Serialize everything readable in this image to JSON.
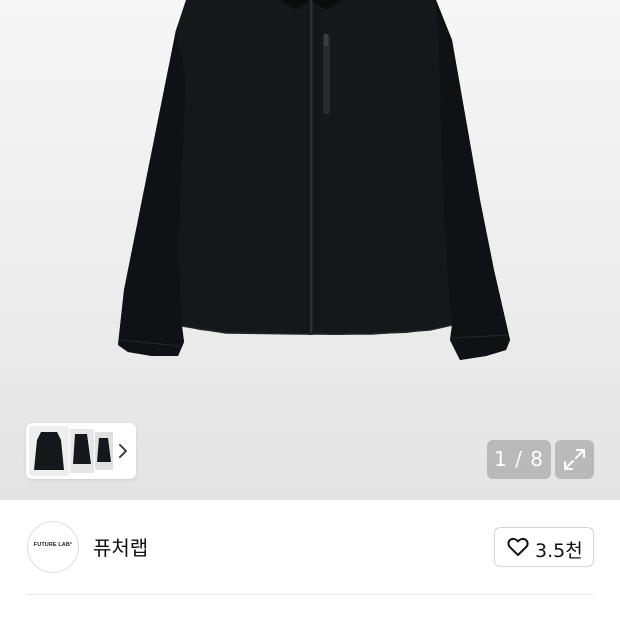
{
  "gallery": {
    "counter": "1 / 8",
    "thumbnails": [
      "jacket-front-thumb",
      "jacket-side-thumb",
      "jacket-back-thumb"
    ]
  },
  "seller": {
    "logo_text": "FUTURE LAB°",
    "name": "퓨처랩"
  },
  "like": {
    "count": "3.5천"
  },
  "icons": {
    "expand": "expand-icon",
    "heart": "heart-icon",
    "next": "chevron-right-icon"
  },
  "colors": {
    "jacket": "#15171b",
    "overlay": "#969696",
    "border": "#d6d6d6"
  }
}
